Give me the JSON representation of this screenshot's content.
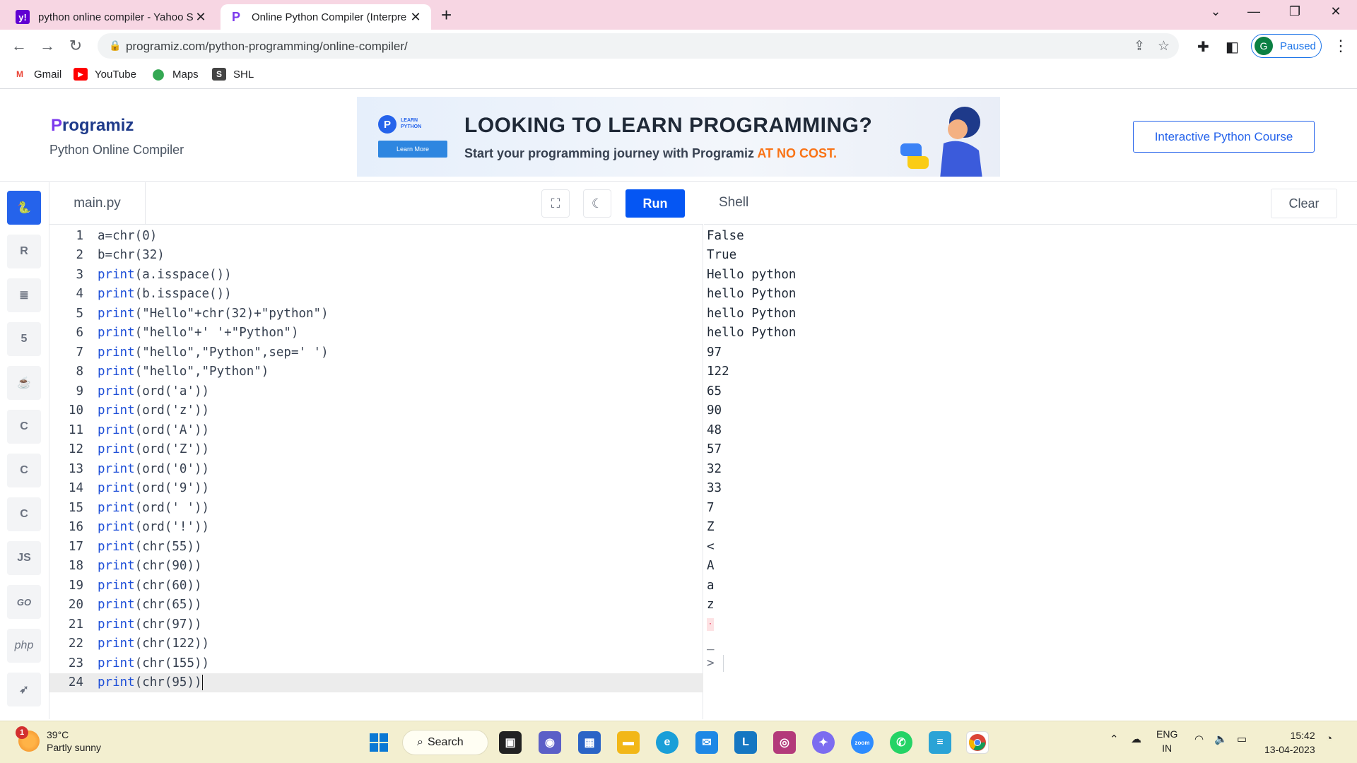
{
  "browser": {
    "tabs": [
      {
        "title": "python online compiler - Yahoo S",
        "favicon": "yahoo-icon",
        "active": false
      },
      {
        "title": "Online Python Compiler (Interpre",
        "favicon": "programiz-icon",
        "active": true
      }
    ],
    "url": "programiz.com/python-programming/online-compiler/",
    "profile_initial": "G",
    "profile_status": "Paused",
    "bookmarks": [
      {
        "label": "Gmail",
        "icon": "gmail-icon"
      },
      {
        "label": "YouTube",
        "icon": "youtube-icon"
      },
      {
        "label": "Maps",
        "icon": "maps-icon"
      },
      {
        "label": "SHL",
        "icon": "shl-icon"
      }
    ]
  },
  "header": {
    "logo_text": "rogramiz",
    "logo_letter": "P",
    "subtitle": "Python Online Compiler",
    "banner": {
      "badge_title": "LEARN\nPYTHON",
      "badge_button": "Learn More",
      "headline": "LOOKING TO LEARN PROGRAMMING?",
      "subline_prefix": "Start your programming journey with Programiz ",
      "subline_highlight": "AT NO COST."
    },
    "course_button": "Interactive Python Course"
  },
  "sidebar": {
    "items": [
      {
        "icon": "python-icon",
        "label": "",
        "active": true
      },
      {
        "icon": "r-icon",
        "label": "R",
        "active": false
      },
      {
        "icon": "database-icon",
        "label": "",
        "active": false
      },
      {
        "icon": "html5-icon",
        "label": "5",
        "active": false
      },
      {
        "icon": "java-icon",
        "label": "",
        "active": false
      },
      {
        "icon": "c-icon",
        "label": "C",
        "active": false
      },
      {
        "icon": "cpp-icon",
        "label": "C",
        "active": false
      },
      {
        "icon": "csharp-icon",
        "label": "C",
        "active": false
      },
      {
        "icon": "javascript-icon",
        "label": "JS",
        "active": false
      },
      {
        "icon": "go-icon",
        "label": "GO",
        "active": false
      },
      {
        "icon": "php-icon",
        "label": "php",
        "active": false
      },
      {
        "icon": "swift-icon",
        "label": "",
        "active": false
      }
    ]
  },
  "editor": {
    "file_name": "main.py",
    "run_label": "Run",
    "current_line": 24,
    "lines": [
      "a=chr(0)",
      "b=chr(32)",
      "print(a.isspace())",
      "print(b.isspace())",
      "print(\"Hello\"+chr(32)+\"python\")",
      "print(\"hello\"+' '+\"Python\")",
      "print(\"hello\",\"Python\",sep=' ')",
      "print(\"hello\",\"Python\")",
      "print(ord('a'))",
      "print(ord('z'))",
      "print(ord('A'))",
      "print(ord('Z'))",
      "print(ord('0'))",
      "print(ord('9'))",
      "print(ord(' '))",
      "print(ord('!'))",
      "print(chr(55))",
      "print(chr(90))",
      "print(chr(60))",
      "print(chr(65))",
      "print(chr(97))",
      "print(chr(122))",
      "print(chr(155))",
      "print(chr(95))"
    ]
  },
  "shell": {
    "title": "Shell",
    "clear_label": "Clear",
    "output": [
      "False",
      "True",
      "Hello python",
      "hello Python",
      "hello Python",
      "hello Python",
      "97",
      "122",
      "65",
      "90",
      "48",
      "57",
      "32",
      "33",
      "7",
      "Z",
      "<",
      "A",
      "a",
      "z",
      "",
      "_"
    ],
    "nonprintable_glyph": "·",
    "prompt": ">"
  },
  "taskbar": {
    "weather_temp": "39°C",
    "weather_desc": "Partly sunny",
    "weather_badge": "1",
    "search_label": "Search",
    "lang_top": "ENG",
    "lang_bottom": "IN",
    "time": "15:42",
    "date": "13-04-2023"
  }
}
